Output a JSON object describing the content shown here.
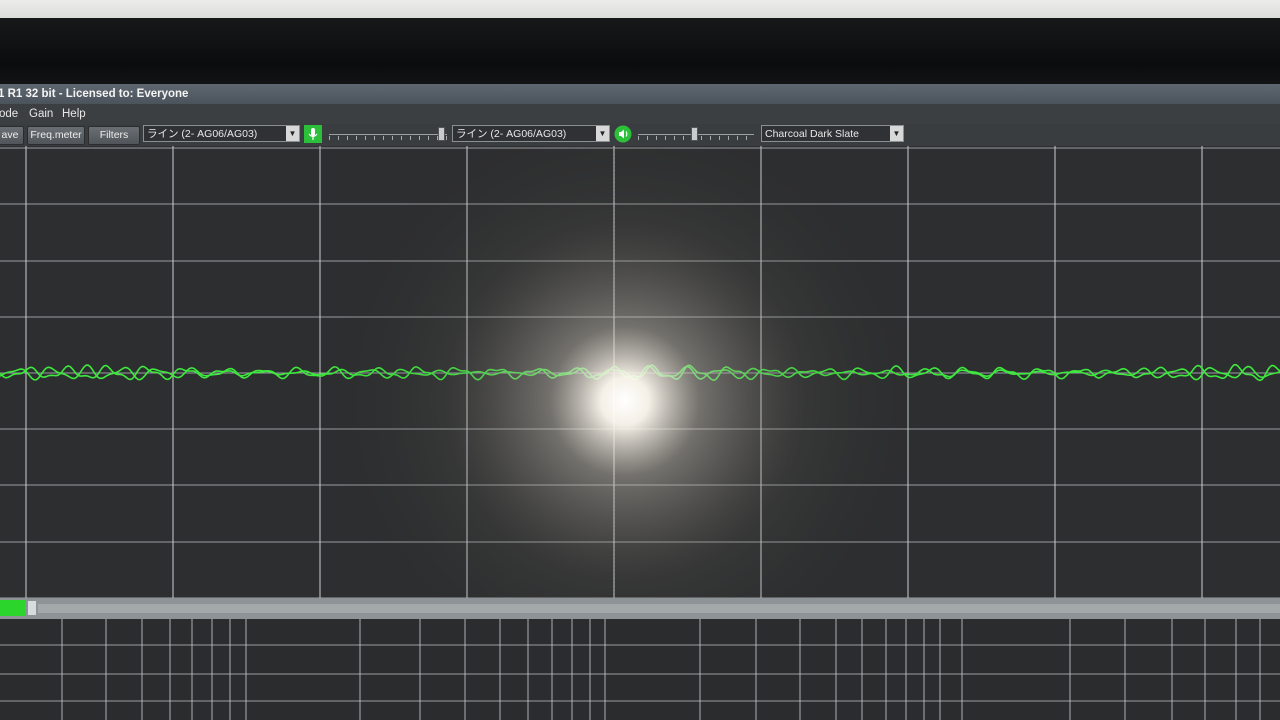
{
  "window": {
    "title": "1 R1 32 bit - Licensed to: Everyone"
  },
  "menu": {
    "items": [
      "ode",
      "Gain",
      "Help"
    ]
  },
  "toolbar": {
    "save_label": "ave",
    "freq_meter_label": "Freq.meter",
    "filters_label": "Filters",
    "input_device": "ライン (2- AG06/AG03)",
    "output_device": "ライン (2- AG06/AG03)",
    "input_level": 0.98,
    "output_level": 0.49,
    "theme": "Charcoal Dark Slate",
    "input_icon": "microphone-icon",
    "output_icon": "speaker-icon"
  },
  "colors": {
    "trace": "#3ee83e",
    "grid": "#c8ccd0",
    "background": "#2d2e2f",
    "accent_green": "#2bd52b"
  }
}
